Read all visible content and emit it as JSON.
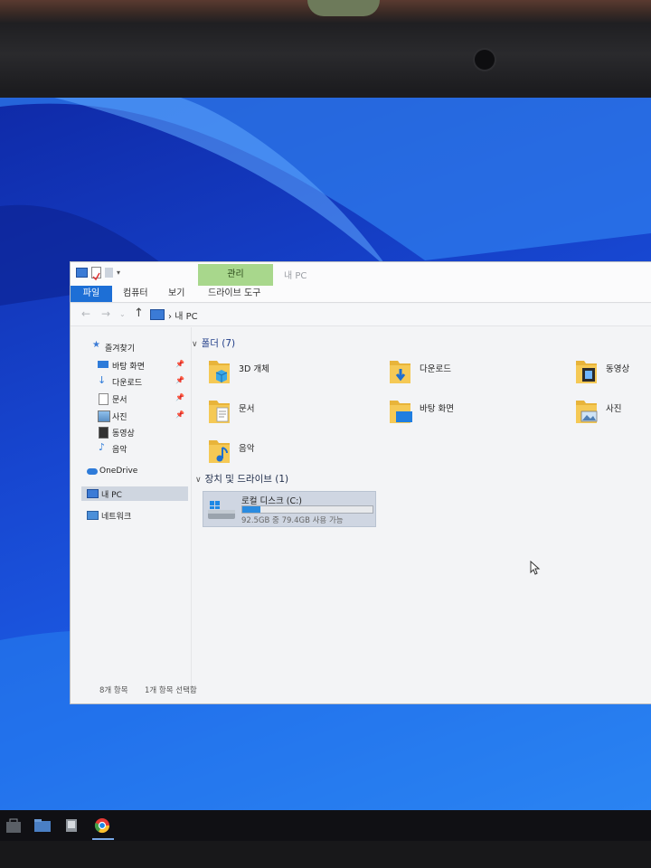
{
  "window": {
    "title": "내 PC",
    "context_tab": "관리",
    "ribbon_tabs": [
      "파일",
      "컴퓨터",
      "보기",
      "드라이브 도구"
    ]
  },
  "address": {
    "breadcrumb": "내 PC"
  },
  "sidebar": {
    "items": [
      {
        "label": "즐겨찾기",
        "icon": "star-icon",
        "pinned": false
      },
      {
        "label": "바탕 화면",
        "icon": "desktop-icon",
        "pinned": true
      },
      {
        "label": "다운로드",
        "icon": "download-icon",
        "pinned": true
      },
      {
        "label": "문서",
        "icon": "document-icon",
        "pinned": true
      },
      {
        "label": "사진",
        "icon": "picture-icon",
        "pinned": true
      },
      {
        "label": "동영상",
        "icon": "video-icon",
        "pinned": false
      },
      {
        "label": "음악",
        "icon": "music-icon",
        "pinned": false
      },
      {
        "label": "OneDrive",
        "icon": "cloud-icon",
        "pinned": false
      },
      {
        "label": "내 PC",
        "icon": "pc-icon",
        "pinned": false,
        "selected": true
      },
      {
        "label": "네트워크",
        "icon": "network-icon",
        "pinned": false
      }
    ]
  },
  "content": {
    "folders_header": "폴더 (7)",
    "folders": [
      {
        "name": "3D 개체",
        "overlay": "cube"
      },
      {
        "name": "다운로드",
        "overlay": "download-arrow"
      },
      {
        "name": "동영상",
        "overlay": "film"
      },
      {
        "name": "문서",
        "overlay": "document"
      },
      {
        "name": "바탕 화면",
        "overlay": "desktop"
      },
      {
        "name": "사진",
        "overlay": "picture"
      },
      {
        "name": "음악",
        "overlay": "music-note"
      }
    ],
    "devices_header": "장치 및 드라이브 (1)",
    "drive": {
      "name": "로컬 디스크 (C:)",
      "status": "92.5GB 중 79.4GB 사용 가능",
      "used_fraction": 0.142
    }
  },
  "status_bar": {
    "item_count": "8개 항목",
    "selected_count": "1개 항목 선택함"
  },
  "colors": {
    "accent": "#1d6fd6",
    "manage_tab": "#a8d78c",
    "folder": "#e8b43a",
    "drive_bar": "#2a8be0"
  }
}
